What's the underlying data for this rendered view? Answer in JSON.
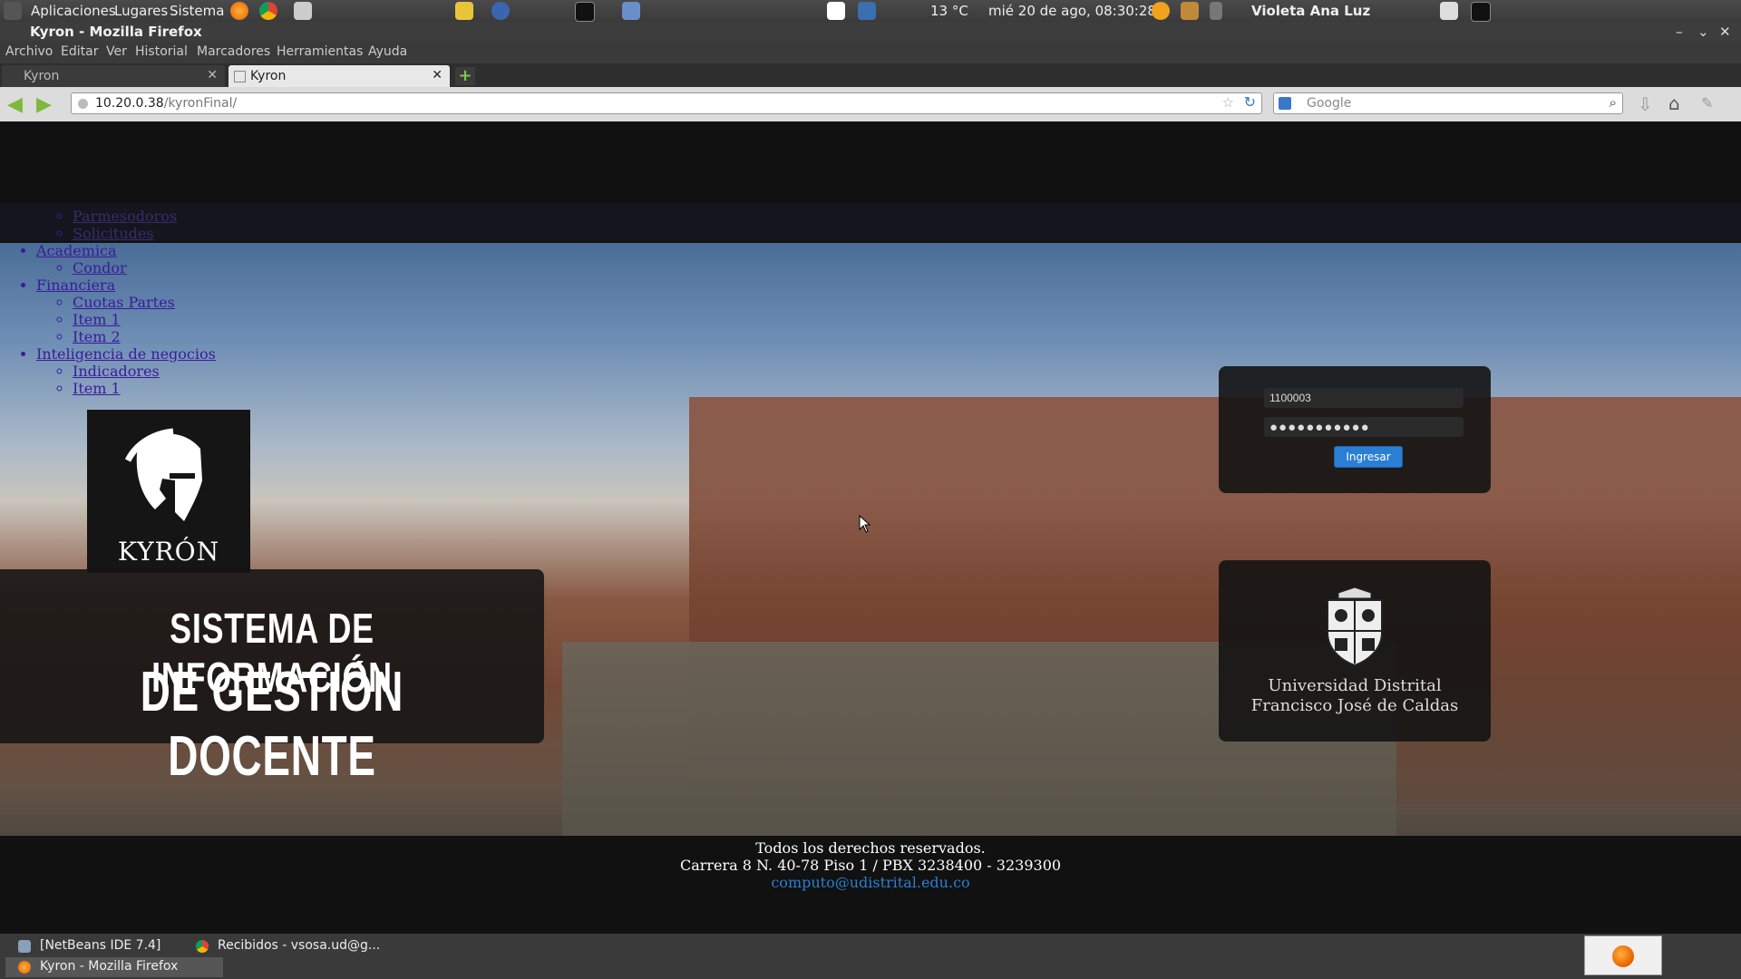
{
  "panel": {
    "menus": [
      "Aplicaciones",
      "Lugares",
      "Sistema"
    ],
    "weather": "13 °C",
    "clock": "mié 20 de ago, 08:30:28",
    "user": "Violeta Ana Luz"
  },
  "window": {
    "title": "Kyron - Mozilla Firefox"
  },
  "menubar": [
    "Archivo",
    "Editar",
    "Ver",
    "Historial",
    "Marcadores",
    "Herramientas",
    "Ayuda"
  ],
  "tabs": [
    {
      "label": "Kyron",
      "active": false
    },
    {
      "label": "Kyron",
      "active": true
    }
  ],
  "nav": {
    "url_host": "10.20.0.38",
    "url_path": "/kyronFinal/",
    "search_placeholder": "Google"
  },
  "sitemenu": {
    "partial": [
      "Parmesodoros",
      "Solicitudes"
    ],
    "groups": [
      {
        "label": "Academica",
        "items": [
          "Condor"
        ]
      },
      {
        "label": "Financiera",
        "items": [
          "Cuotas Partes",
          "Item 1",
          "Item 2"
        ]
      },
      {
        "label": "Inteligencia de negocios",
        "items": [
          "Indicadores",
          "Item 1"
        ]
      }
    ]
  },
  "brand": {
    "logo_text": "KYRÓN",
    "title_line1": "SISTEMA DE INFORMACIÓN",
    "title_line2": "DE GESTIÓN DOCENTE"
  },
  "login": {
    "username_value": "1100003",
    "password_mask": "●●●●●●●●●●●",
    "button_label": "Ingresar"
  },
  "university": {
    "line1": "Universidad Distrital",
    "line2": "Francisco José de Caldas"
  },
  "footer": {
    "rights": "Todos los derechos reservados.",
    "address": "Carrera 8 N. 40-78 Piso 1 / PBX 3238400 - 3239300",
    "email": "computo@udistrital.edu.co"
  },
  "taskbar": {
    "tasks": [
      {
        "label": "[NetBeans IDE 7.4]"
      },
      {
        "label": "Recibidos - vsosa.ud@g..."
      },
      {
        "label": "Kyron - Mozilla Firefox"
      }
    ]
  },
  "colors": {
    "accent": "#2a7fd4",
    "link": "#3b1a9c",
    "panel": "#3a3a3a"
  }
}
